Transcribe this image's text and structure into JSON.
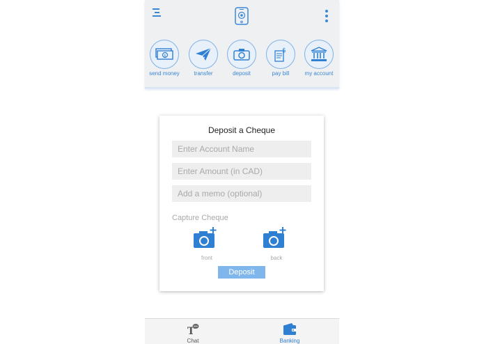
{
  "header": {
    "menu_icon": "menu-icon",
    "logo_icon": "phone-logo-icon",
    "more_icon": "more-vertical-icon"
  },
  "actions": [
    {
      "label": "send money",
      "icon": "money-icon"
    },
    {
      "label": "transfer",
      "icon": "paper-plane-icon"
    },
    {
      "label": "deposit",
      "icon": "camera-icon"
    },
    {
      "label": "pay bill",
      "icon": "bill-icon"
    },
    {
      "label": "my account",
      "icon": "bank-icon"
    }
  ],
  "deposit_card": {
    "title": "Deposit a Cheque",
    "account_name_placeholder": "Enter Account Name",
    "amount_placeholder": "Enter Amount (in CAD)",
    "memo_placeholder": "Add a memo (optional)",
    "capture_title": "Capture Cheque",
    "front_label": "front",
    "back_label": "back",
    "deposit_label": "Deposit"
  },
  "bottom_nav": [
    {
      "label": "Chat",
      "icon": "chat-icon",
      "active": false
    },
    {
      "label": "Banking",
      "icon": "wallet-icon",
      "active": true
    }
  ],
  "colors": {
    "accent": "#3a87d8",
    "button": "#7fb6ec",
    "header_bg": "#eff0f1"
  }
}
